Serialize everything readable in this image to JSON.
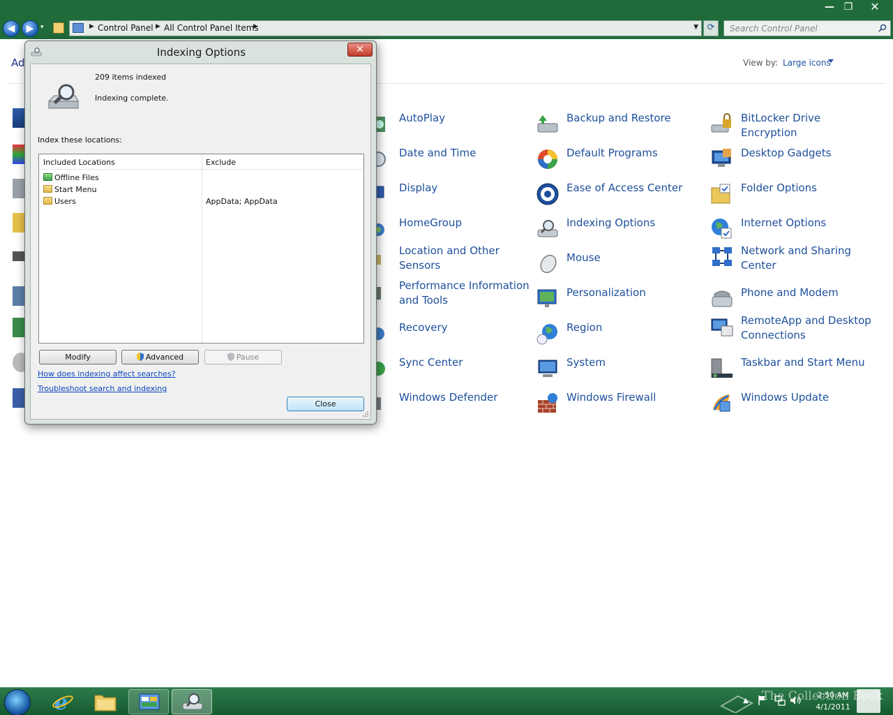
{
  "window": {
    "title_buttons": {
      "minimize": "—",
      "maximize": "❐",
      "close": "✕"
    },
    "nav": {
      "back": "◀",
      "forward": "▶",
      "history": "▾",
      "refresh": "⟳"
    },
    "breadcrumb": [
      "Control Panel",
      "All Control Panel Items"
    ],
    "search_placeholder": "Search Control Panel"
  },
  "control_panel": {
    "adjust_text_visible": "Ad",
    "view_by_label": "View by:",
    "view_by_value": "Large icons",
    "items": [
      {
        "label": "AutoPlay",
        "icon": "autoplay-icon"
      },
      {
        "label": "Backup and Restore",
        "icon": "backup-icon"
      },
      {
        "label": "BitLocker Drive Encryption",
        "icon": "bitlocker-icon"
      },
      {
        "label": "Date and Time",
        "icon": "clock-icon"
      },
      {
        "label": "Default Programs",
        "icon": "default-programs-icon"
      },
      {
        "label": "Desktop Gadgets",
        "icon": "gadgets-icon"
      },
      {
        "label": "Display",
        "icon": "display-icon"
      },
      {
        "label": "Ease of Access Center",
        "icon": "ease-of-access-icon"
      },
      {
        "label": "Folder Options",
        "icon": "folder-options-icon"
      },
      {
        "label": "HomeGroup",
        "icon": "homegroup-icon"
      },
      {
        "label": "Indexing Options",
        "icon": "indexing-icon"
      },
      {
        "label": "Internet Options",
        "icon": "internet-options-icon"
      },
      {
        "label": "Location and Other Sensors",
        "icon": "sensors-icon"
      },
      {
        "label": "Mouse",
        "icon": "mouse-icon"
      },
      {
        "label": "Network and Sharing Center",
        "icon": "network-icon"
      },
      {
        "label": "Performance Information and Tools",
        "icon": "performance-icon"
      },
      {
        "label": "Personalization",
        "icon": "personalization-icon"
      },
      {
        "label": "Phone and Modem",
        "icon": "phone-icon"
      },
      {
        "label": "Recovery",
        "icon": "recovery-icon"
      },
      {
        "label": "Region",
        "icon": "region-icon"
      },
      {
        "label": "RemoteApp and Desktop Connections",
        "icon": "remoteapp-icon"
      },
      {
        "label": "Sync Center",
        "icon": "sync-icon"
      },
      {
        "label": "System",
        "icon": "system-icon"
      },
      {
        "label": "Taskbar and Start Menu",
        "icon": "taskbar-icon"
      },
      {
        "label": "Windows Defender",
        "icon": "defender-icon"
      },
      {
        "label": "Windows Firewall",
        "icon": "firewall-icon"
      },
      {
        "label": "Windows Update",
        "icon": "update-icon"
      }
    ]
  },
  "dialog": {
    "title": "Indexing Options",
    "close_glyph": "✕",
    "items_indexed": "209 items indexed",
    "status": "Indexing complete.",
    "locations_heading": "Index these locations:",
    "columns": {
      "included": "Included Locations",
      "exclude": "Exclude"
    },
    "locations": [
      {
        "name": "Offline Files",
        "exclude": ""
      },
      {
        "name": "Start Menu",
        "exclude": ""
      },
      {
        "name": "Users",
        "exclude": "AppData; AppData"
      }
    ],
    "buttons": {
      "modify": "Modify",
      "advanced": "Advanced",
      "pause": "Pause",
      "close": "Close"
    },
    "links": {
      "affect": "How does indexing affect searches?",
      "troubleshoot": "Troubleshoot search and indexing"
    }
  },
  "taskbar": {
    "clock_time": "2:50 AM",
    "clock_date": "4/1/2011",
    "tray_up": "▲",
    "watermark": "The Collection Book"
  },
  "colors": {
    "chrome_green": "#1f6b3a",
    "link_blue": "#1e4f9c",
    "dialog_close_red": "#c13b2a"
  }
}
